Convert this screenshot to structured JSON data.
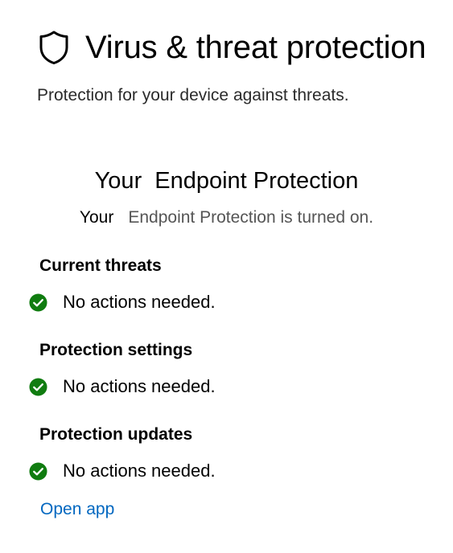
{
  "header": {
    "title": "Virus & threat protection",
    "subtitle": "Protection for your device against threats.",
    "icon": "shield-icon"
  },
  "provider": {
    "title_prefix": "Your",
    "title_name": "Endpoint Protection",
    "status_prefix": "Your",
    "status_text": "Endpoint Protection is turned on."
  },
  "sections": [
    {
      "heading": "Current threats",
      "status": "No actions needed.",
      "status_icon": "check-circle-icon"
    },
    {
      "heading": "Protection settings",
      "status": "No actions needed.",
      "status_icon": "check-circle-icon"
    },
    {
      "heading": "Protection updates",
      "status": "No actions needed.",
      "status_icon": "check-circle-icon"
    }
  ],
  "actions": {
    "open_app": "Open app"
  },
  "colors": {
    "success": "#107c10",
    "link": "#0067c0",
    "text": "#000000",
    "muted": "#555555"
  }
}
